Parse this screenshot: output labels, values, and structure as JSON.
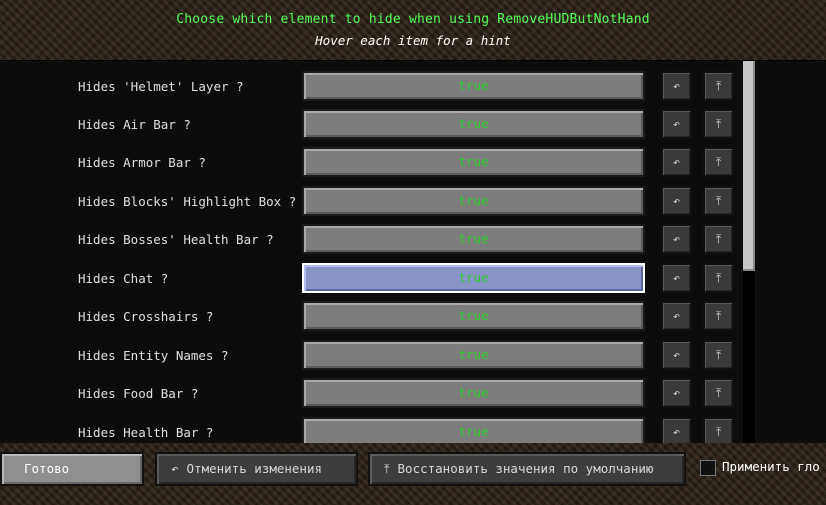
{
  "header": {
    "title": "Choose which element to hide when using RemoveHUDButNotHand",
    "hint": "Hover each item for a hint"
  },
  "rows": [
    {
      "label": "Hides 'Helmet' Layer ?",
      "value": "true"
    },
    {
      "label": "Hides Air Bar ?",
      "value": "true"
    },
    {
      "label": "Hides Armor Bar ?",
      "value": "true"
    },
    {
      "label": "Hides Blocks' Highlight Box ?",
      "value": "true"
    },
    {
      "label": "Hides Bosses' Health Bar ?",
      "value": "true"
    },
    {
      "label": "Hides Chat ?",
      "value": "true"
    },
    {
      "label": "Hides Crosshairs ?",
      "value": "true"
    },
    {
      "label": "Hides Entity Names ?",
      "value": "true"
    },
    {
      "label": "Hides Food Bar ?",
      "value": "true"
    },
    {
      "label": "Hides Health Bar ?",
      "value": "true"
    }
  ],
  "icons": {
    "undo": "↶",
    "reset": "⤒"
  },
  "footer": {
    "done": "Готово",
    "cancel": "Отменить изменения",
    "cancel_icon": "↶",
    "restore": "Восстановить значения по умолчанию",
    "restore_icon": "⤒",
    "apply": "Применить гло"
  }
}
